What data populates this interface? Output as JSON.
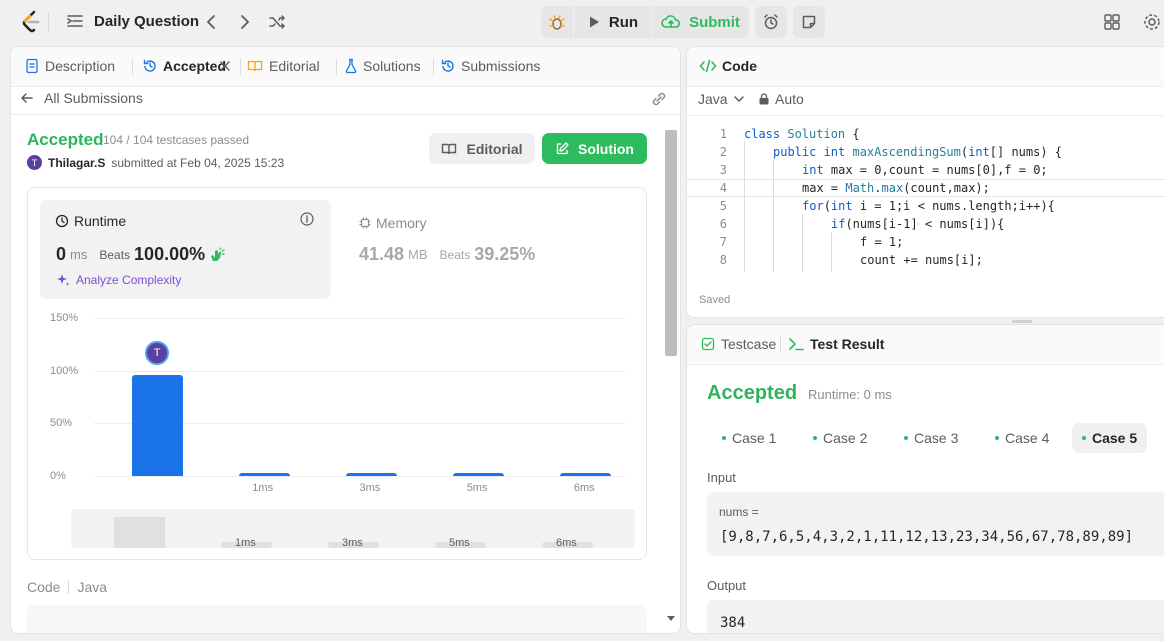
{
  "nav": {
    "title": "Daily Question",
    "run_label": "Run",
    "submit_label": "Submit"
  },
  "left_tabs": [
    {
      "label": "Description"
    },
    {
      "label": "Accepted"
    },
    {
      "label": "Editorial"
    },
    {
      "label": "Solutions"
    },
    {
      "label": "Submissions"
    }
  ],
  "submission": {
    "back_label": "All Submissions",
    "status": "Accepted",
    "testcases": "104 / 104 testcases passed",
    "user_initial": "T",
    "user": "Thilagar.S",
    "submitted_text": "submitted at Feb 04, 2025 15:23",
    "editorial_btn": "Editorial",
    "solution_btn": "Solution"
  },
  "runtime": {
    "label": "Runtime",
    "value": "0",
    "unit": "ms",
    "beats_label": "Beats",
    "beats": "100.00%",
    "analyze": "Analyze Complexity"
  },
  "memory": {
    "label": "Memory",
    "value": "41.48",
    "unit": "MB",
    "beats_label": "Beats",
    "beats": "39.25%"
  },
  "chart_data": {
    "type": "bar",
    "categories": [
      "",
      "1ms",
      "3ms",
      "5ms",
      "6ms"
    ],
    "values": [
      96,
      3,
      3,
      3,
      3
    ],
    "y_ticks": [
      "150%",
      "100%",
      "50%",
      "0%"
    ],
    "ylim": [
      0,
      150
    ],
    "marker_initial": "T",
    "grid": true
  },
  "mini_labels": [
    "1ms",
    "3ms",
    "5ms",
    "6ms"
  ],
  "code_footer": {
    "label": "Code",
    "lang": "Java",
    "preview": "class Solution {"
  },
  "editor": {
    "title": "Code",
    "language": "Java",
    "mode": "Auto",
    "saved": "Saved",
    "lines": [
      {
        "n": "1",
        "indent": 0,
        "parts": [
          {
            "t": "class ",
            "c": "kw"
          },
          {
            "t": "Solution",
            "c": "cls"
          },
          {
            "t": " {",
            "c": "plain"
          }
        ]
      },
      {
        "n": "2",
        "indent": 1,
        "parts": [
          {
            "t": "public int ",
            "c": "kw"
          },
          {
            "t": "maxAscendingSum",
            "c": "cls"
          },
          {
            "t": "(",
            "c": "plain"
          },
          {
            "t": "int",
            "c": "kw"
          },
          {
            "t": "[] nums) {",
            "c": "plain"
          }
        ]
      },
      {
        "n": "3",
        "indent": 2,
        "parts": [
          {
            "t": "int ",
            "c": "kw"
          },
          {
            "t": "max = 0,count = nums[0],f = 0;",
            "c": "plain"
          }
        ]
      },
      {
        "n": "4",
        "indent": 2,
        "parts": [
          {
            "t": "max = ",
            "c": "plain"
          },
          {
            "t": "Math",
            "c": "cls"
          },
          {
            "t": ".",
            "c": "plain"
          },
          {
            "t": "max",
            "c": "cls"
          },
          {
            "t": "(count,max);",
            "c": "plain"
          }
        ]
      },
      {
        "n": "5",
        "indent": 2,
        "parts": [
          {
            "t": "for",
            "c": "kw"
          },
          {
            "t": "(",
            "c": "plain"
          },
          {
            "t": "int ",
            "c": "kw"
          },
          {
            "t": "i = 1;i < nums.length;i++){",
            "c": "plain"
          }
        ]
      },
      {
        "n": "6",
        "indent": 3,
        "parts": [
          {
            "t": "if",
            "c": "kw"
          },
          {
            "t": "(nums[i-1] < nums[i]){",
            "c": "plain"
          }
        ]
      },
      {
        "n": "7",
        "indent": 4,
        "parts": [
          {
            "t": "f = 1;",
            "c": "plain"
          }
        ]
      },
      {
        "n": "8",
        "indent": 4,
        "parts": [
          {
            "t": "count += nums[i];",
            "c": "plain"
          }
        ]
      }
    ]
  },
  "testpanel": {
    "testcase_tab": "Testcase",
    "result_tab": "Test Result",
    "status": "Accepted",
    "runtime": "Runtime: 0 ms",
    "cases": [
      "Case 1",
      "Case 2",
      "Case 3",
      "Case 4",
      "Case 5"
    ],
    "input_label": "Input",
    "var_name": "nums =",
    "var_value": "[9,8,7,6,5,4,3,2,1,11,12,13,23,34,56,67,78,89,89]",
    "output_label": "Output",
    "output_value": "384"
  },
  "colors": {
    "accent_green": "#2cbb5d",
    "bar_blue": "#1a73e8",
    "avatar": "#5b3fa3"
  }
}
